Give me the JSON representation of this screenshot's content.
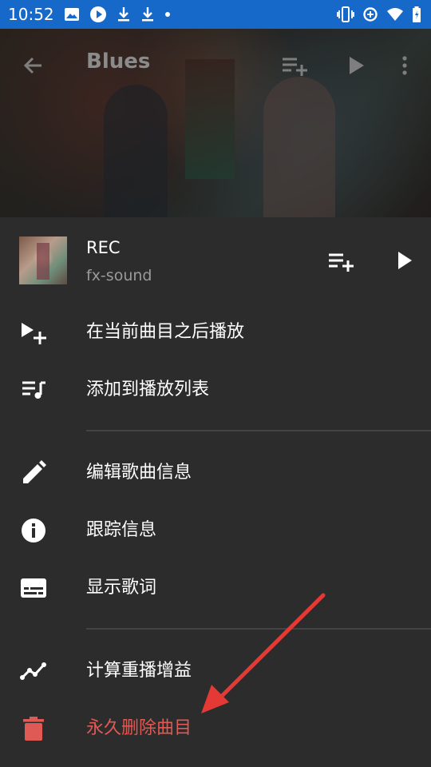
{
  "status_bar": {
    "time": "10:52",
    "background": "#1769c9",
    "left_icons": [
      "image-icon",
      "play-circle-icon",
      "download-icon",
      "download-icon",
      "dot-icon"
    ],
    "right_icons": [
      "vibrate-icon",
      "data-saver-icon",
      "wifi-icon",
      "battery-icon"
    ]
  },
  "toolbar": {
    "title": "Blues"
  },
  "song": {
    "title": "REC",
    "artist": "fx-sound"
  },
  "menu": {
    "items": [
      {
        "label": "在当前曲目之后播放",
        "icon": "play-next-icon"
      },
      {
        "label": "添加到播放列表",
        "icon": "playlist-add-icon"
      },
      {
        "label": "编辑歌曲信息",
        "icon": "pencil-icon"
      },
      {
        "label": "跟踪信息",
        "icon": "info-icon"
      },
      {
        "label": "显示歌词",
        "icon": "subtitles-icon"
      },
      {
        "label": "计算重播增益",
        "icon": "trending-icon"
      },
      {
        "label": "永久删除曲目",
        "icon": "trash-icon"
      }
    ]
  },
  "colors": {
    "sheet_background": "#2c2c2c",
    "danger": "#e05a55",
    "annotation_arrow": "#e53935"
  }
}
